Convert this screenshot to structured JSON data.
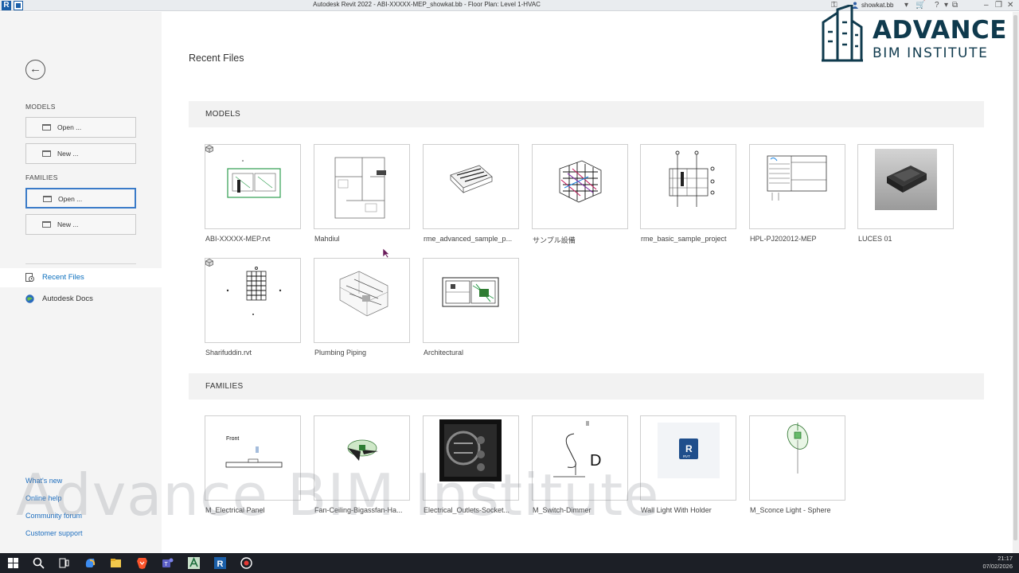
{
  "titlebar": {
    "title": "Autodesk Revit 2022 - ABI-XXXXX-MEP_showkat.bb - Floor Plan: Level 1-HVAC",
    "user": "showkat.bb",
    "app_icon": "R"
  },
  "sidebar": {
    "models_heading": "MODELS",
    "families_heading": "FAMILIES",
    "models_open": "Open ...",
    "models_new": "New ...",
    "families_open": "Open ...",
    "families_new": "New ...",
    "nav": [
      {
        "label": "Recent Files",
        "icon": "recent-files-icon"
      },
      {
        "label": "Autodesk Docs",
        "icon": "autodesk-docs-icon"
      }
    ],
    "links": [
      "What's new",
      "Online help",
      "Community forum",
      "Customer support"
    ]
  },
  "main": {
    "title": "Recent Files",
    "models_section": "MODELS",
    "families_section": "FAMILIES",
    "models": [
      {
        "label": "ABI-XXXXX-MEP.rvt",
        "thumb": "plan-green",
        "local": true
      },
      {
        "label": "Mahdiul",
        "thumb": "plan-grey",
        "local": false
      },
      {
        "label": "rme_advanced_sample_p...",
        "thumb": "iso-grey",
        "local": false
      },
      {
        "label": "サンプル設備",
        "thumb": "iso-colour",
        "local": false
      },
      {
        "label": "rme_basic_sample_project",
        "thumb": "section",
        "local": false
      },
      {
        "label": "HPL-PJ202012-MEP",
        "thumb": "titleblock",
        "local": false
      },
      {
        "label": "LUCES 01",
        "thumb": "render-box",
        "local": false
      },
      {
        "label": "Sharifuddin.rvt",
        "thumb": "grid-plan",
        "local": true
      },
      {
        "label": "Plumbing Piping",
        "thumb": "pipe-iso",
        "local": false
      },
      {
        "label": "Architectural",
        "thumb": "arch-plan",
        "local": false
      }
    ],
    "families": [
      {
        "label": "M_Electrical Panel",
        "thumb": "panel-front",
        "front_text": "Front"
      },
      {
        "label": "Fan-Ceiling-Bigassfan-Ha...",
        "thumb": "fan"
      },
      {
        "label": "Electrical_Outlets-Socket...",
        "thumb": "outlets"
      },
      {
        "label": "M_Switch-Dimmer",
        "thumb": "switch",
        "symbol_text": "D"
      },
      {
        "label": "Wall Light With Holder",
        "thumb": "rvt-icon",
        "rvt_text": "R",
        "rvt_sub": "RVT"
      },
      {
        "label": "M_Sconce Light - Sphere",
        "thumb": "sconce"
      }
    ]
  },
  "logo": {
    "line1": "ADVANCE",
    "line2": "BIM INSTITUTE"
  },
  "watermark": "Advance BIM Institute",
  "taskbar": {
    "time": "21:17",
    "date": "07/02/2026",
    "apps": [
      "windows-start-icon",
      "search-icon",
      "task-view-icon",
      "copilot-icon",
      "file-explorer-icon",
      "brave-browser-icon",
      "teams-icon",
      "autocad-icon",
      "revit-icon",
      "screen-recorder-icon"
    ]
  },
  "colors": {
    "accent": "#3a7bc8",
    "link": "#1f6fbf",
    "logo": "#0f3a4d",
    "taskbar": "#1c1f26"
  }
}
